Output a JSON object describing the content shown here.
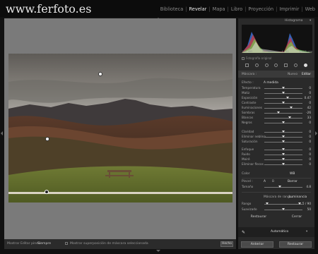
{
  "brand": {
    "site": "www.ferfoto.es"
  },
  "modules": [
    {
      "label": "Biblioteca",
      "active": false
    },
    {
      "label": "Revelar",
      "active": true
    },
    {
      "label": "Mapa",
      "active": false
    },
    {
      "label": "Libro",
      "active": false
    },
    {
      "label": "Proyección",
      "active": false
    },
    {
      "label": "Imprimir",
      "active": false
    },
    {
      "label": "Web",
      "active": false
    }
  ],
  "panel": {
    "histogram_title": "Histograma",
    "histogram_info": [
      "100 ISO",
      "50 mm",
      "f / 11",
      "1/125 seg"
    ],
    "original_photo_label": "Fotografía original",
    "mask_label": "Máscara :",
    "mask_new": "Nuevo",
    "mask_edit": "Editar",
    "effect_label": "Efecto :",
    "effect_value": "A medida",
    "color_label": "Color",
    "wb_value": "WB",
    "range_mask_label": "Máscara de rango :",
    "range_mask_value": "Luminancia",
    "range_label": "Rango",
    "range_value": "5 / 90",
    "smooth_label": "Suavizado",
    "smooth_value": "50",
    "reset_label": "Restaurar",
    "close_label": "Cerrar",
    "brush_label": "Pincel :",
    "brush_a": "A",
    "brush_b": "B",
    "brush_erase": "Borrar",
    "size_label": "Tamaño",
    "size_value": "4.8",
    "auto_label": "Automático",
    "previous_button": "Anterior",
    "reset_button": "Restaurar"
  },
  "sliders": [
    {
      "label": "Temperatura",
      "value": "0",
      "position": 0.5
    },
    {
      "label": "Matiz",
      "value": "0",
      "position": 0.5
    },
    {
      "label": "Exposición",
      "value": "0.47",
      "position": 0.62
    },
    {
      "label": "Contraste",
      "value": "0",
      "position": 0.5
    },
    {
      "label": "Iluminaciones",
      "value": "42",
      "position": 0.71
    },
    {
      "label": "Sombras",
      "value": "-26",
      "position": 0.37
    },
    {
      "label": "Blancos",
      "value": "33",
      "position": 0.66
    },
    {
      "label": "Negros",
      "value": "0",
      "position": 0.5
    },
    {
      "label": "Claridad",
      "value": "0",
      "position": 0.5
    },
    {
      "label": "Eliminar neblina",
      "value": "0",
      "position": 0.5
    },
    {
      "label": "Saturación",
      "value": "0",
      "position": 0.5
    },
    {
      "label": "Enfoque",
      "value": "0",
      "position": 0.5
    },
    {
      "label": "Ruido",
      "value": "0",
      "position": 0.5
    },
    {
      "label": "Moiré",
      "value": "0",
      "position": 0.5
    },
    {
      "label": "Eliminar flecos",
      "value": "0",
      "position": 0.5
    }
  ],
  "toolbar": {
    "overlay_label": "Mostrar Editar pines:",
    "overlay_value": "Siempre",
    "show_mask_label": "Mostrar superposición de máscara seleccionada",
    "done_button": "Hecho"
  },
  "colors": {
    "accent": "#e8e8e8",
    "panel": "#2a2a2a",
    "canvas": "#7a7a7a"
  }
}
